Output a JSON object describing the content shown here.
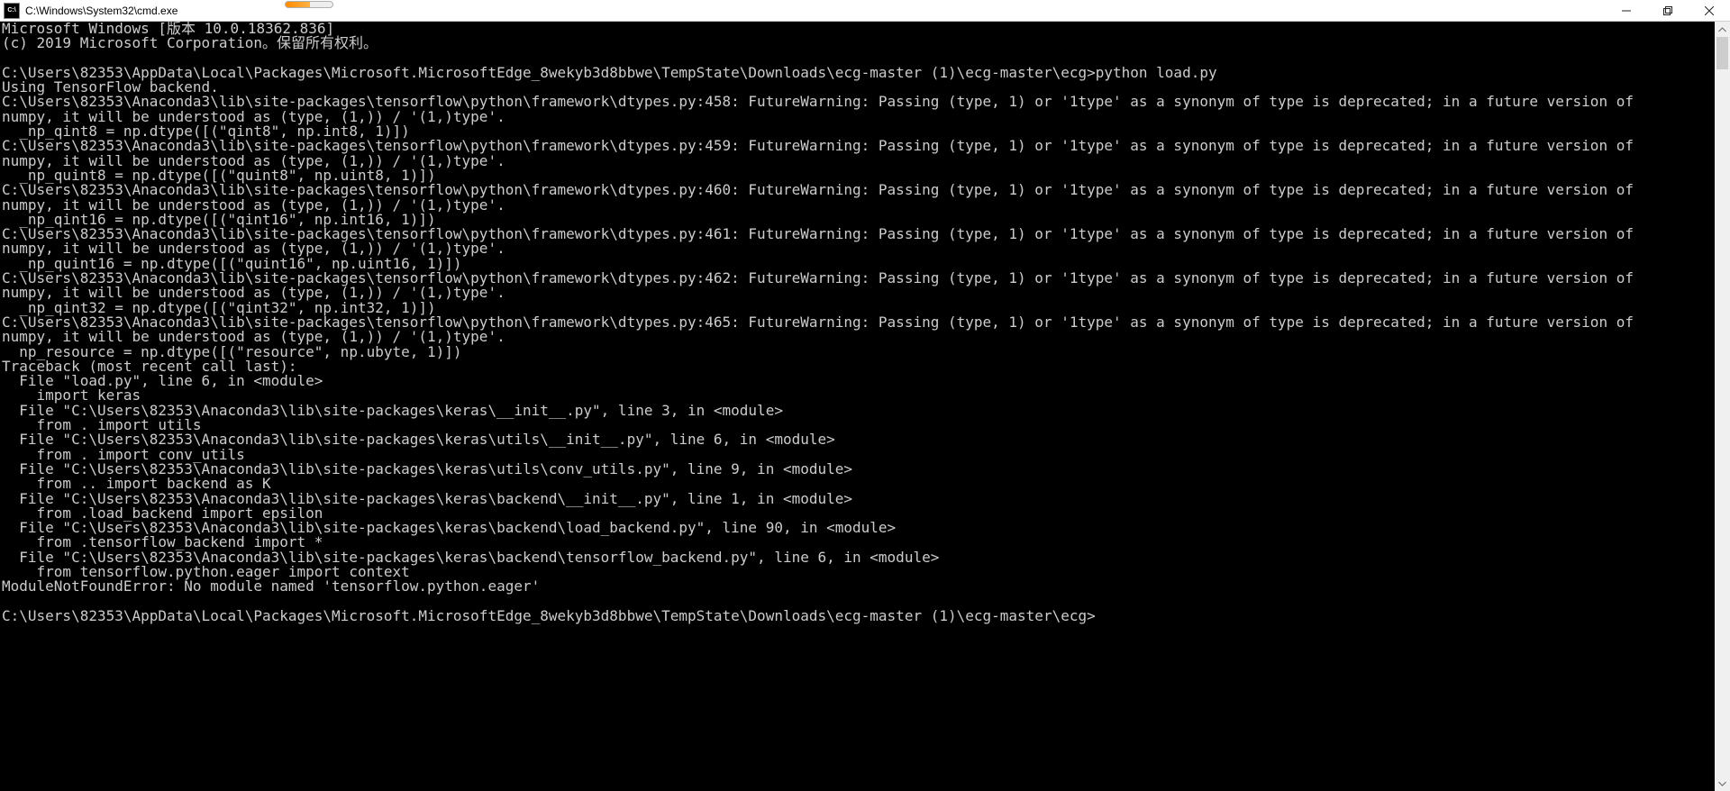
{
  "titlebar": {
    "icon_label": "C:\\",
    "title": "C:\\Windows\\System32\\cmd.exe"
  },
  "lines": [
    "Microsoft Windows [版本 10.0.18362.836]",
    "(c) 2019 Microsoft Corporation。保留所有权利。",
    "",
    "C:\\Users\\82353\\AppData\\Local\\Packages\\Microsoft.MicrosoftEdge_8wekyb3d8bbwe\\TempState\\Downloads\\ecg-master (1)\\ecg-master\\ecg>python load.py",
    "Using TensorFlow backend.",
    "C:\\Users\\82353\\Anaconda3\\lib\\site-packages\\tensorflow\\python\\framework\\dtypes.py:458: FutureWarning: Passing (type, 1) or '1type' as a synonym of type is deprecated; in a future version of",
    "numpy, it will be understood as (type, (1,)) / '(1,)type'.",
    "  _np_qint8 = np.dtype([(\"qint8\", np.int8, 1)])",
    "C:\\Users\\82353\\Anaconda3\\lib\\site-packages\\tensorflow\\python\\framework\\dtypes.py:459: FutureWarning: Passing (type, 1) or '1type' as a synonym of type is deprecated; in a future version of",
    "numpy, it will be understood as (type, (1,)) / '(1,)type'.",
    "  _np_quint8 = np.dtype([(\"quint8\", np.uint8, 1)])",
    "C:\\Users\\82353\\Anaconda3\\lib\\site-packages\\tensorflow\\python\\framework\\dtypes.py:460: FutureWarning: Passing (type, 1) or '1type' as a synonym of type is deprecated; in a future version of",
    "numpy, it will be understood as (type, (1,)) / '(1,)type'.",
    "  _np_qint16 = np.dtype([(\"qint16\", np.int16, 1)])",
    "C:\\Users\\82353\\Anaconda3\\lib\\site-packages\\tensorflow\\python\\framework\\dtypes.py:461: FutureWarning: Passing (type, 1) or '1type' as a synonym of type is deprecated; in a future version of",
    "numpy, it will be understood as (type, (1,)) / '(1,)type'.",
    "  _np_quint16 = np.dtype([(\"quint16\", np.uint16, 1)])",
    "C:\\Users\\82353\\Anaconda3\\lib\\site-packages\\tensorflow\\python\\framework\\dtypes.py:462: FutureWarning: Passing (type, 1) or '1type' as a synonym of type is deprecated; in a future version of",
    "numpy, it will be understood as (type, (1,)) / '(1,)type'.",
    "  _np_qint32 = np.dtype([(\"qint32\", np.int32, 1)])",
    "C:\\Users\\82353\\Anaconda3\\lib\\site-packages\\tensorflow\\python\\framework\\dtypes.py:465: FutureWarning: Passing (type, 1) or '1type' as a synonym of type is deprecated; in a future version of",
    "numpy, it will be understood as (type, (1,)) / '(1,)type'.",
    "  np_resource = np.dtype([(\"resource\", np.ubyte, 1)])",
    "Traceback (most recent call last):",
    "  File \"load.py\", line 6, in <module>",
    "    import keras",
    "  File \"C:\\Users\\82353\\Anaconda3\\lib\\site-packages\\keras\\__init__.py\", line 3, in <module>",
    "    from . import utils",
    "  File \"C:\\Users\\82353\\Anaconda3\\lib\\site-packages\\keras\\utils\\__init__.py\", line 6, in <module>",
    "    from . import conv_utils",
    "  File \"C:\\Users\\82353\\Anaconda3\\lib\\site-packages\\keras\\utils\\conv_utils.py\", line 9, in <module>",
    "    from .. import backend as K",
    "  File \"C:\\Users\\82353\\Anaconda3\\lib\\site-packages\\keras\\backend\\__init__.py\", line 1, in <module>",
    "    from .load_backend import epsilon",
    "  File \"C:\\Users\\82353\\Anaconda3\\lib\\site-packages\\keras\\backend\\load_backend.py\", line 90, in <module>",
    "    from .tensorflow_backend import *",
    "  File \"C:\\Users\\82353\\Anaconda3\\lib\\site-packages\\keras\\backend\\tensorflow_backend.py\", line 6, in <module>",
    "    from tensorflow.python.eager import context",
    "ModuleNotFoundError: No module named 'tensorflow.python.eager'",
    "",
    "C:\\Users\\82353\\AppData\\Local\\Packages\\Microsoft.MicrosoftEdge_8wekyb3d8bbwe\\TempState\\Downloads\\ecg-master (1)\\ecg-master\\ecg>"
  ]
}
